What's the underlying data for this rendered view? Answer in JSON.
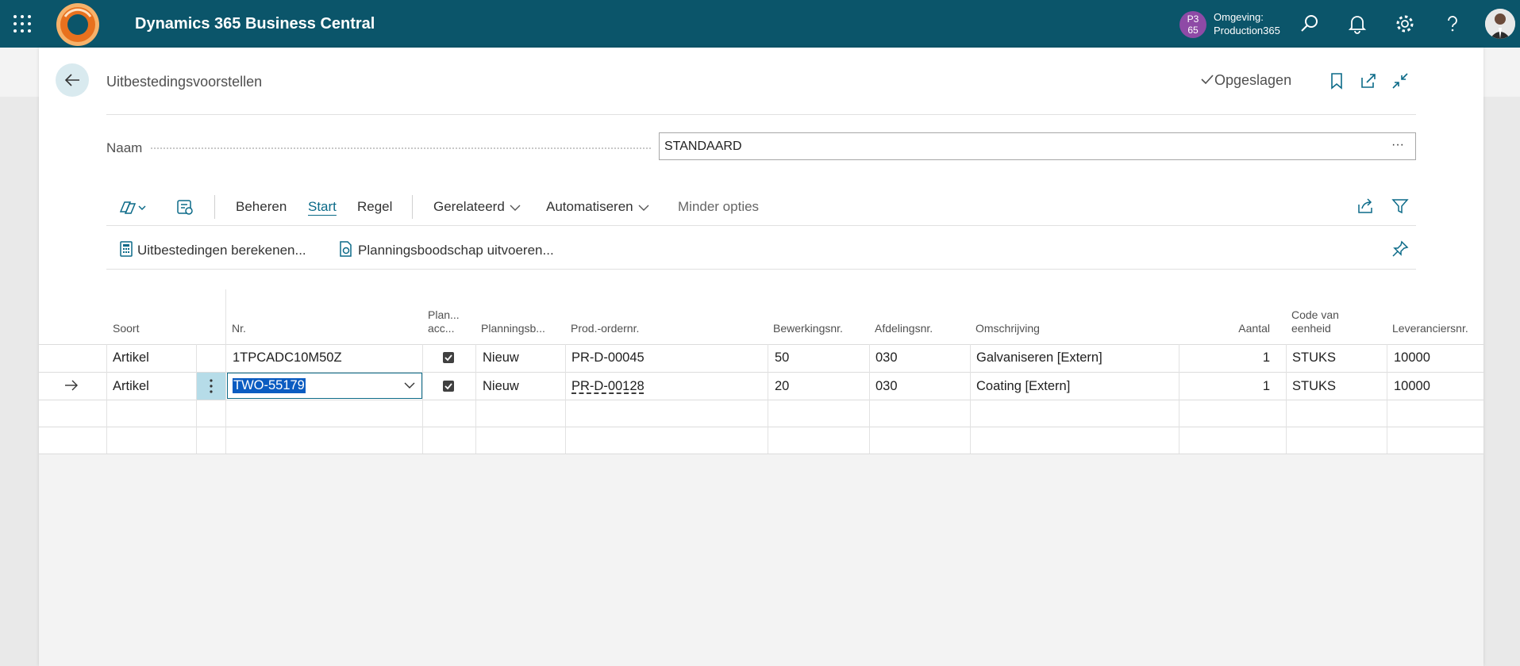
{
  "app": {
    "title": "Dynamics 365 Business Central",
    "env_badge": "P3\n65",
    "env_label": "Omgeving:",
    "env_value": "Production365",
    "icons": [
      "app-launcher-icon",
      "search-icon",
      "bell-icon",
      "gear-icon",
      "help-icon"
    ]
  },
  "page": {
    "title": "Uitbestedingsvoorstellen",
    "saved_status": "Opgeslagen",
    "name_label": "Naam",
    "name_value": "STANDAARD",
    "name_more": "···"
  },
  "actions": {
    "beheren": "Beheren",
    "start": "Start",
    "regel": "Regel",
    "gerelateerd": "Gerelateerd",
    "automatiseren": "Automatiseren",
    "minder": "Minder opties",
    "active": "Start"
  },
  "promoted": {
    "calc": "Uitbestedingen berekenen...",
    "carry": "Planningsboodschap uitvoeren..."
  },
  "grid": {
    "headers": {
      "soort": "Soort",
      "nr": "Nr.",
      "plan1": "Plan...",
      "plan2": "acc...",
      "planningsb": "Planningsb...",
      "prod": "Prod.-ordernr.",
      "bewerk": "Bewerkingsnr.",
      "afdeling": "Afdelingsnr.",
      "omschr": "Omschrijving",
      "aantal": "Aantal",
      "code1": "Code van",
      "code2": "eenheid",
      "lev": "Leveranciersnr."
    },
    "rows": [
      {
        "soort": "Artikel",
        "nr": "1TPCADC10M50Z",
        "accepted": true,
        "planningsb": "Nieuw",
        "prod": "PR-D-00045",
        "bewerk": "50",
        "afdeling": "030",
        "omschr": "Galvaniseren [Extern]",
        "aantal": "1",
        "code": "STUKS",
        "lev": "10000"
      },
      {
        "soort": "Artikel",
        "nr": "TWO-55179",
        "accepted": true,
        "planningsb": "Nieuw",
        "prod": "PR-D-00128",
        "bewerk": "20",
        "afdeling": "030",
        "omschr": "Coating [Extern]",
        "aantal": "1",
        "code": "STUKS",
        "lev": "10000"
      }
    ]
  }
}
